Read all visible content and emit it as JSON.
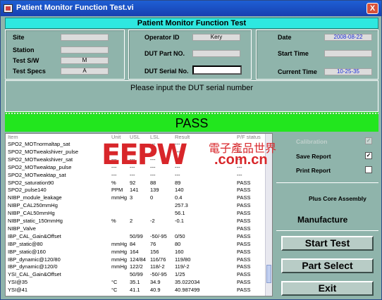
{
  "window": {
    "title": "Patient Monitor Function Test.vi",
    "close_label": "X"
  },
  "banner": "Patient Monitor Function Test",
  "left_group": {
    "site": {
      "label": "Site",
      "value": ""
    },
    "station": {
      "label": "Station",
      "value": ""
    },
    "test_sw": {
      "label": "Test S/W",
      "value": "M"
    },
    "test_specs": {
      "label": "Test Specs",
      "value": "A"
    }
  },
  "mid_group": {
    "operator_id": {
      "label": "Operator ID",
      "value": "Kery"
    },
    "dut_part_no": {
      "label": "DUT Part NO.",
      "value": ""
    },
    "dut_serial_no": {
      "label": "DUT Serial No.",
      "value": ""
    }
  },
  "right_group": {
    "date": {
      "label": "Date",
      "value": "2008-08-22"
    },
    "start_time": {
      "label": "Start Time",
      "value": ""
    },
    "current_time": {
      "label": "Current Time",
      "value": "10-25-35"
    }
  },
  "message": "Please input the DUT serial number",
  "result": "PASS",
  "table": {
    "headers": [
      "Item",
      "Unit",
      "USL",
      "LSL",
      "Result",
      "P/F status"
    ],
    "rows": [
      [
        "SPO2_MOTnormaltap_sat",
        "---",
        "---",
        "---",
        "---",
        "---"
      ],
      [
        "SPO2_MOTweakshiver_pulse",
        "---",
        "---",
        "---",
        "---",
        "---"
      ],
      [
        "SPO2_MOTweakshiver_sat",
        "---",
        "---",
        "---",
        "---",
        "---"
      ],
      [
        "SPO2_MOTweaktap_pulse",
        "---",
        "---",
        "---",
        "---",
        "---"
      ],
      [
        "SPO2_MOTweaktap_sat",
        "---",
        "---",
        "---",
        "---",
        "---"
      ],
      [
        "SPO2_saturation90",
        "%",
        "92",
        "88",
        "89",
        "PASS"
      ],
      [
        "SPO2_pulse140",
        "PPM",
        "141",
        "139",
        "140",
        "PASS"
      ],
      [
        "NIBP_module_leakage",
        "mmHg",
        "3",
        "0",
        "0.4",
        "PASS"
      ],
      [
        "NIBP_CAL250mmHg",
        "",
        "",
        "",
        "257.3",
        "PASS"
      ],
      [
        "NIBP_CAL50mmHg",
        "",
        "",
        "",
        "56.1",
        "PASS"
      ],
      [
        "NIBP_static_150mmHg",
        "%",
        "2",
        "-2",
        "-0.1",
        "PASS"
      ],
      [
        "NIBP_Valve",
        "",
        "",
        "",
        "",
        "PASS"
      ],
      [
        "IBP_CAL_Gain&Offset",
        "",
        "50/99",
        "-50/-95",
        "0/50",
        "PASS"
      ],
      [
        "IBP_static@80",
        "mmHg",
        "84",
        "76",
        "80",
        "PASS"
      ],
      [
        "IBP_static@160",
        "mmHg",
        "164",
        "156",
        "160",
        "PASS"
      ],
      [
        "IBP_dynamic@120/80",
        "mmHg",
        "124/84",
        "116/76",
        "119/80",
        "PASS"
      ],
      [
        "IBP_dynamic@120/0",
        "mmHg",
        "122/2",
        "118/-2",
        "119/-2",
        "PASS"
      ],
      [
        "YSI_CAL_Gain&Offset",
        "",
        "50/99",
        "-50/-95",
        "1/25",
        "PASS"
      ],
      [
        "YSI@35",
        "°C",
        "35.1",
        "34.9",
        "35.022034",
        "PASS"
      ],
      [
        "YSI@41",
        "°C",
        "41.1",
        "40.9",
        "40.987499",
        "PASS"
      ]
    ]
  },
  "watermark": {
    "big": "EEPW",
    "chinese": "電子產品世界",
    "com": ".com.cn"
  },
  "side": {
    "calibration": {
      "label": "Calibration",
      "checked": "✓"
    },
    "save_report": {
      "label": "Save Report",
      "checked": "✓"
    },
    "print_report": {
      "label": "Print Report",
      "checked": ""
    },
    "assembly": "Plus Core Assembly",
    "mode": "Manufacture",
    "start_test": "Start Test",
    "part_select": "Part Select",
    "exit": "Exit"
  }
}
